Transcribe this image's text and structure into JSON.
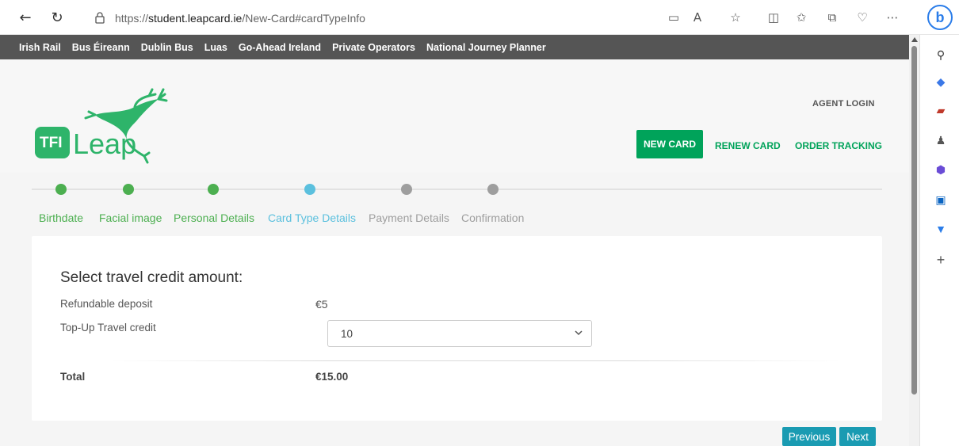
{
  "browser": {
    "url_prefix": "https://",
    "url_domain": "student.leapcard.ie",
    "url_path": "/New-Card#cardTypeInfo",
    "bing_label": "b"
  },
  "operators": [
    "Irish Rail",
    "Bus Éireann",
    "Dublin Bus",
    "Luas",
    "Go-Ahead Ireland",
    "Private Operators",
    "National Journey Planner"
  ],
  "header": {
    "logo_badge": "TFI",
    "logo_text": "Leap",
    "agent_login": "AGENT LOGIN",
    "nav": {
      "new_card": "NEW CARD",
      "renew_card": "RENEW CARD",
      "order_tracking": "ORDER TRACKING"
    },
    "brand_color": "#00a35a"
  },
  "steps": [
    {
      "label": "Birthdate",
      "status": "done"
    },
    {
      "label": "Facial image",
      "status": "done"
    },
    {
      "label": "Personal Details",
      "status": "done"
    },
    {
      "label": "Card Type Details",
      "status": "current"
    },
    {
      "label": "Payment Details",
      "status": "pending"
    },
    {
      "label": "Confirmation",
      "status": "pending"
    }
  ],
  "colors": {
    "done": "#4caf50",
    "current": "#5bc0de",
    "pending": "#9e9e9e"
  },
  "form": {
    "title": "Select travel credit amount:",
    "deposit_label": "Refundable deposit",
    "deposit_value": "€5",
    "topup_label": "Top-Up Travel credit",
    "topup_value": "10",
    "total_label": "Total",
    "total_value": "€15.00"
  },
  "buttons": {
    "previous": "Previous",
    "next": "Next"
  }
}
